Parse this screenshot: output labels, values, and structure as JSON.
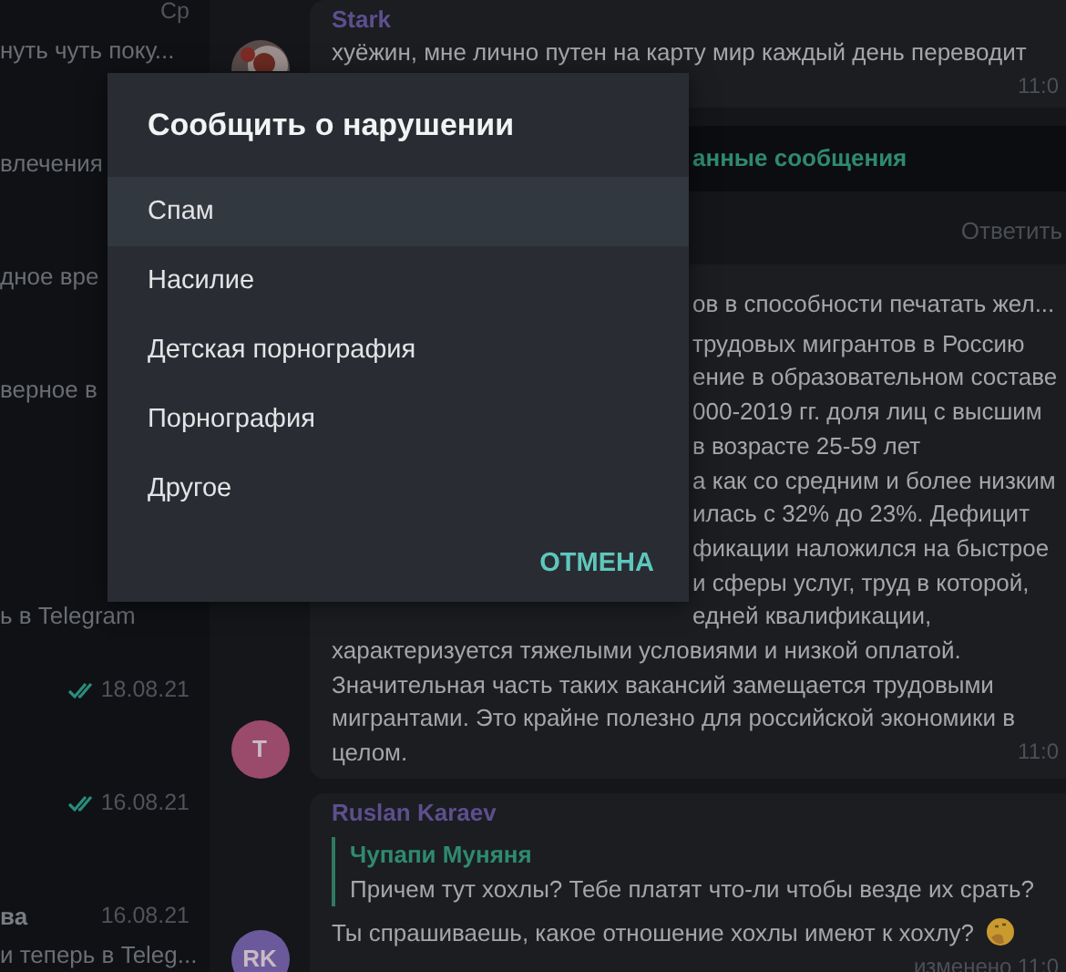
{
  "sidebar": {
    "top_chats": [
      {
        "date": "Ср",
        "preview": "нуть чуть поку..."
      },
      {
        "preview": "влечения"
      },
      {
        "preview": "дное вре"
      },
      {
        "preview": "верное в"
      }
    ],
    "bottom_chats": [
      {
        "preview": "ь в Telegram"
      },
      {
        "date": "18.08.21",
        "read": true
      },
      {
        "date": "16.08.21",
        "read": true
      },
      {
        "name": "ва",
        "date": "16.08.21",
        "read": false,
        "preview": "и теперь в Teleg..."
      }
    ]
  },
  "chat": {
    "items": [
      {
        "kind": "message",
        "author": "Stark",
        "lines": [
          {
            "text": "хуёжин, мне лично путен на карту мир каждый день переводит"
          }
        ],
        "time": "11:0"
      },
      {
        "kind": "unread_bar",
        "label": "анные сообщения"
      },
      {
        "kind": "action",
        "label": "Ответить"
      },
      {
        "kind": "message",
        "avatar": {
          "kind": "initials",
          "text": "T",
          "color": "#9a4a6b"
        },
        "lines": [
          {
            "text": "ов в способности печатать жел...",
            "covered": true
          },
          {
            "text": "трудовых мигрантов в Россию",
            "covered": true
          },
          {
            "text": "ение в образовательном составе",
            "covered": true
          },
          {
            "text": "000-2019 гг. доля лиц с высшим",
            "covered": true
          },
          {
            "text": "в возрасте 25-59 лет",
            "covered": true
          },
          {
            "text": "а как со средним и более низким",
            "covered": true
          },
          {
            "text": "илась с 32% до 23%. Дефицит",
            "covered": true
          },
          {
            "text": "фикации наложился на быстрое",
            "covered": true
          },
          {
            "text": "и сферы услуг, труд в которой,",
            "covered": true
          },
          {
            "text": "едней квалификации,",
            "covered": true
          },
          {
            "text": "характеризуется тяжелыми условиями и низкой оплатой."
          },
          {
            "text": "Значительная часть таких вакансий замещается трудовыми"
          },
          {
            "text": "мигрантами. Это крайне полезно для российской экономики в"
          },
          {
            "text": "целом."
          }
        ],
        "time": "11:0"
      },
      {
        "kind": "message",
        "author": "Ruslan Karaev",
        "avatar": {
          "kind": "initials",
          "text": "RK",
          "color": "#6b5a9b"
        },
        "quote": {
          "author": "Чупапи Муняня",
          "text": "Причем тут хохлы? Тебе платят что-ли чтобы везде их срать?"
        },
        "lines": [
          {
            "text": "Ты спрашиваешь, какое отношение хохлы имеют к хохлу?",
            "emoji": true
          }
        ],
        "time": "изменено 11:0"
      }
    ]
  },
  "dialog": {
    "title": "Сообщить о нарушении",
    "options": [
      {
        "label": "Спам",
        "selected": true
      },
      {
        "label": "Насилие",
        "selected": false
      },
      {
        "label": "Детская порнография",
        "selected": false
      },
      {
        "label": "Порнография",
        "selected": false
      },
      {
        "label": "Другое",
        "selected": false
      }
    ],
    "cancel": "ОТМЕНА"
  }
}
